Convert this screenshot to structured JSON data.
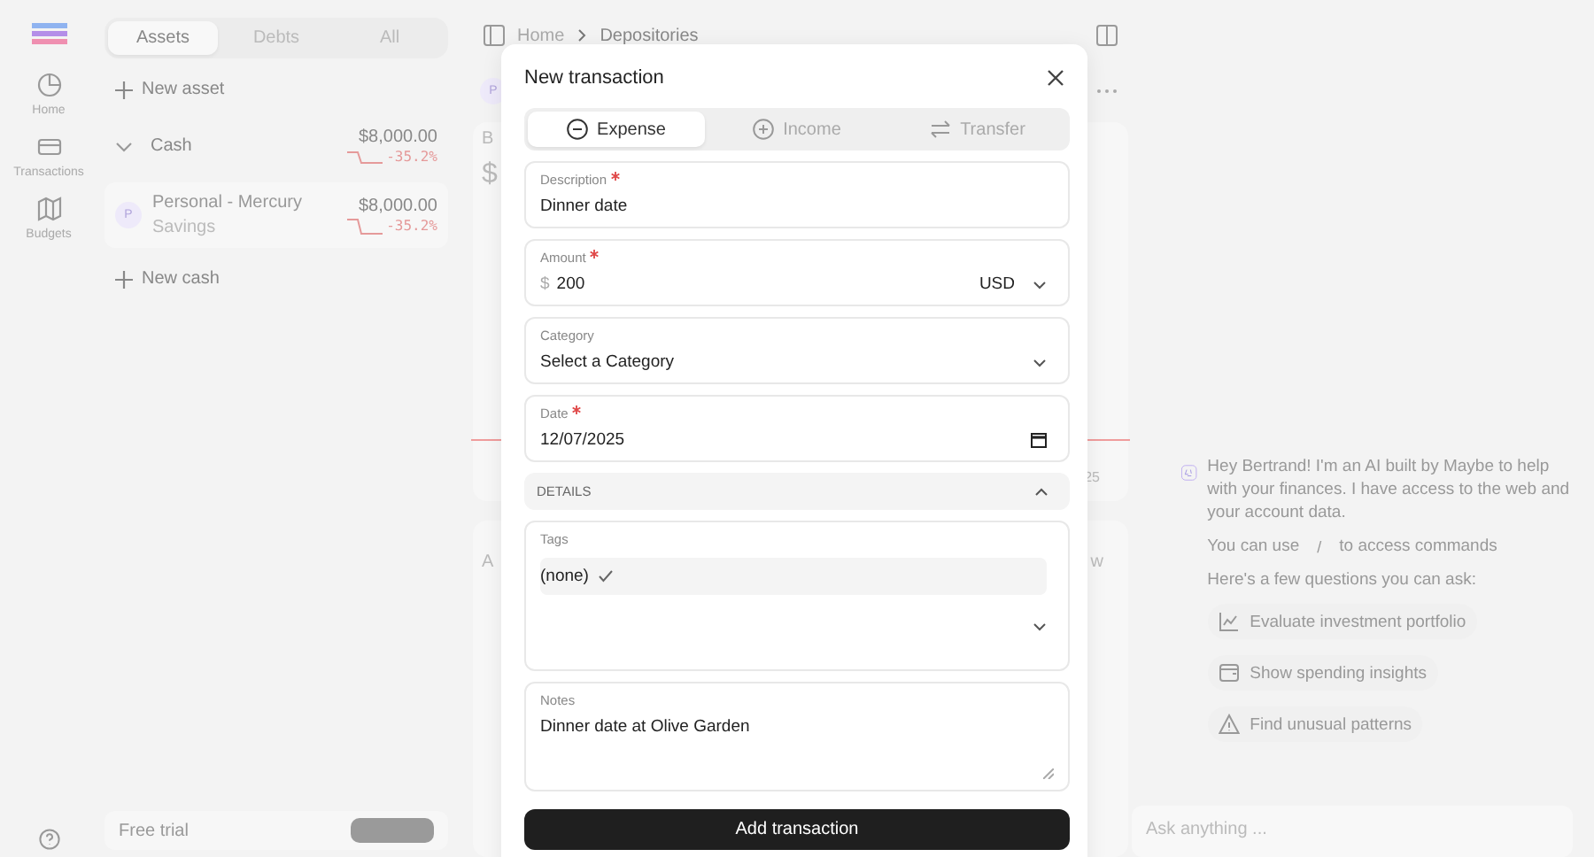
{
  "app_nav": {
    "items": [
      {
        "label": "Home"
      },
      {
        "label": "Transactions"
      },
      {
        "label": "Budgets"
      }
    ]
  },
  "accounts": {
    "tabs": [
      {
        "label": "Assets",
        "selected": true
      },
      {
        "label": "Debts",
        "selected": false
      },
      {
        "label": "All",
        "selected": false
      }
    ],
    "new_asset": "New asset",
    "groups": [
      {
        "name": "Cash",
        "expanded": true,
        "balance": "$8,000.00",
        "change": "-35.2%",
        "accounts": [
          {
            "initial": "P",
            "name": "Personal - Mercury",
            "subtype": "Savings",
            "balance": "$8,000.00",
            "change": "-35.2%"
          }
        ]
      }
    ],
    "new_cash": "New cash",
    "trial": {
      "title": "Free trial"
    }
  },
  "breadcrumbs": [
    "Home",
    "Depositories"
  ],
  "account_header": {
    "initial": "P"
  },
  "balance_card": {
    "label": "B",
    "value": "$",
    "date_fragment": "25"
  },
  "activity_card": {
    "title": "A",
    "action": "w"
  },
  "modal": {
    "title": "New transaction",
    "types": [
      {
        "kind": "expense",
        "label": "Expense",
        "selected": true
      },
      {
        "kind": "income",
        "label": "Income",
        "selected": false
      },
      {
        "kind": "transfer",
        "label": "Transfer",
        "selected": false
      }
    ],
    "fields": [
      {
        "kind": "text",
        "label": "Description",
        "required": true,
        "value": "Dinner date"
      },
      {
        "kind": "amount",
        "label": "Amount",
        "required": true,
        "symbol": "$",
        "value": "200",
        "currency": "USD"
      },
      {
        "kind": "select",
        "label": "Category",
        "required": false,
        "value": "Select a Category"
      },
      {
        "kind": "date",
        "label": "Date",
        "required": true,
        "value": "12/07/2025"
      }
    ],
    "details": {
      "title": "DETAILS",
      "expanded": true,
      "tags": {
        "label": "Tags",
        "options": [
          {
            "label": "(none)",
            "checked": true
          }
        ]
      },
      "notes": {
        "label": "Notes",
        "value": "Dinner date at Olive Garden"
      }
    },
    "submit": "Add transaction"
  },
  "chat": {
    "intro": "Hey Bertrand! I'm an AI built by Maybe to help with your finances. I have access to the web and your account data.",
    "commands": {
      "before": "You can use",
      "key": "/",
      "after": "to access commands"
    },
    "prompt": "Here's a few questions you can ask:",
    "suggestions": [
      {
        "kind": "chart",
        "label": "Evaluate investment portfolio"
      },
      {
        "kind": "wallet",
        "label": "Show spending insights"
      },
      {
        "kind": "alert",
        "label": "Find unusual patterns"
      }
    ],
    "input": {
      "placeholder": "Ask anything ..."
    }
  }
}
